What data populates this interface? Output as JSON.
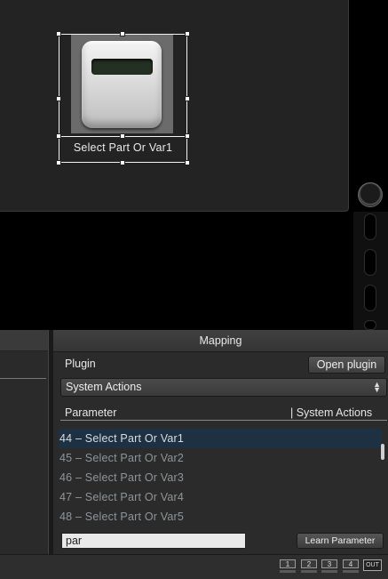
{
  "widget": {
    "label": "Select Part Or Var1"
  },
  "mapping": {
    "title": "Mapping",
    "plugin_label": "Plugin",
    "open_plugin_label": "Open plugin",
    "selected_plugin": "System Actions",
    "column_parameter": "Parameter",
    "column_system_actions": "| System Actions",
    "parameters": [
      "44 – Select Part Or Var1",
      "45 – Select Part Or Var2",
      "46 – Select Part Or Var3",
      "47 – Select Part Or Var4",
      "48 – Select Part Or Var5"
    ],
    "selected_index": 0,
    "search_value": "par",
    "learn_parameter_label": "Learn Parameter"
  },
  "statusbar": {
    "channels": [
      "1",
      "2",
      "3",
      "4"
    ],
    "out_label": "OUT"
  },
  "colors": {
    "selection_row": "#1e3142",
    "canvas_bg": "#232323",
    "panel_bg": "#2b2b2b"
  }
}
